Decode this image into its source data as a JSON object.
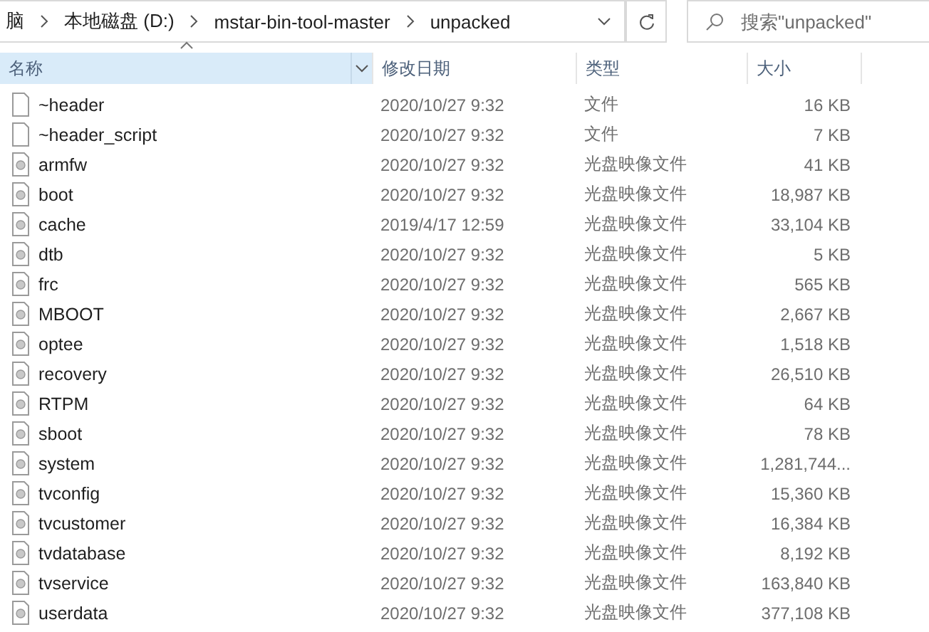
{
  "address_bar": {
    "crumbs": [
      "脑",
      "本地磁盘 (D:)",
      "mstar-bin-tool-master",
      "unpacked"
    ]
  },
  "search": {
    "placeholder": "搜索\"unpacked\""
  },
  "columns": [
    {
      "label": "名称",
      "selected": true,
      "sorted": true
    },
    {
      "label": "修改日期",
      "selected": false,
      "sorted": false
    },
    {
      "label": "类型",
      "selected": false,
      "sorted": false
    },
    {
      "label": "大小",
      "selected": false,
      "sorted": false
    }
  ],
  "files": [
    {
      "kind": "file",
      "name": "~header",
      "modified": "2020/10/27 9:32",
      "type": "文件",
      "size": "16 KB"
    },
    {
      "kind": "file",
      "name": "~header_script",
      "modified": "2020/10/27 9:32",
      "type": "文件",
      "size": "7 KB"
    },
    {
      "kind": "disc-image",
      "name": "armfw",
      "modified": "2020/10/27 9:32",
      "type": "光盘映像文件",
      "size": "41 KB"
    },
    {
      "kind": "disc-image",
      "name": "boot",
      "modified": "2020/10/27 9:32",
      "type": "光盘映像文件",
      "size": "18,987 KB"
    },
    {
      "kind": "disc-image",
      "name": "cache",
      "modified": "2019/4/17 12:59",
      "type": "光盘映像文件",
      "size": "33,104 KB"
    },
    {
      "kind": "disc-image",
      "name": "dtb",
      "modified": "2020/10/27 9:32",
      "type": "光盘映像文件",
      "size": "5 KB"
    },
    {
      "kind": "disc-image",
      "name": "frc",
      "modified": "2020/10/27 9:32",
      "type": "光盘映像文件",
      "size": "565 KB"
    },
    {
      "kind": "disc-image",
      "name": "MBOOT",
      "modified": "2020/10/27 9:32",
      "type": "光盘映像文件",
      "size": "2,667 KB"
    },
    {
      "kind": "disc-image",
      "name": "optee",
      "modified": "2020/10/27 9:32",
      "type": "光盘映像文件",
      "size": "1,518 KB"
    },
    {
      "kind": "disc-image",
      "name": "recovery",
      "modified": "2020/10/27 9:32",
      "type": "光盘映像文件",
      "size": "26,510 KB"
    },
    {
      "kind": "disc-image",
      "name": "RTPM",
      "modified": "2020/10/27 9:32",
      "type": "光盘映像文件",
      "size": "64 KB"
    },
    {
      "kind": "disc-image",
      "name": "sboot",
      "modified": "2020/10/27 9:32",
      "type": "光盘映像文件",
      "size": "78 KB"
    },
    {
      "kind": "disc-image",
      "name": "system",
      "modified": "2020/10/27 9:32",
      "type": "光盘映像文件",
      "size": "1,281,744..."
    },
    {
      "kind": "disc-image",
      "name": "tvconfig",
      "modified": "2020/10/27 9:32",
      "type": "光盘映像文件",
      "size": "15,360 KB"
    },
    {
      "kind": "disc-image",
      "name": "tvcustomer",
      "modified": "2020/10/27 9:32",
      "type": "光盘映像文件",
      "size": "16,384 KB"
    },
    {
      "kind": "disc-image",
      "name": "tvdatabase",
      "modified": "2020/10/27 9:32",
      "type": "光盘映像文件",
      "size": "8,192 KB"
    },
    {
      "kind": "disc-image",
      "name": "tvservice",
      "modified": "2020/10/27 9:32",
      "type": "光盘映像文件",
      "size": "163,840 KB"
    },
    {
      "kind": "disc-image",
      "name": "userdata",
      "modified": "2020/10/27 9:32",
      "type": "光盘映像文件",
      "size": "377,108 KB"
    }
  ]
}
